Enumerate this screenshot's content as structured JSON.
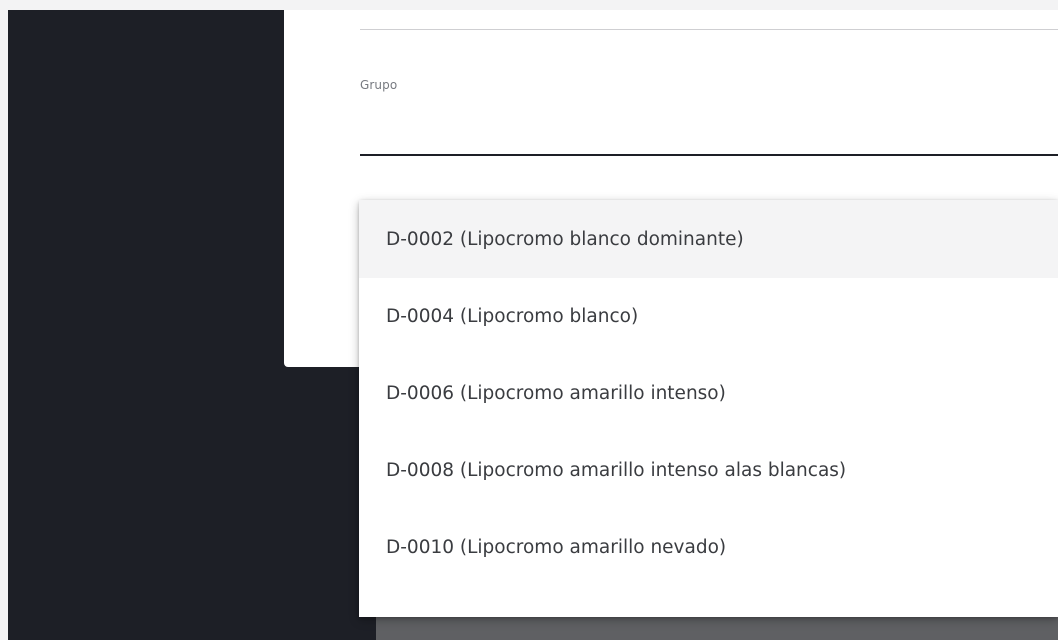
{
  "form": {
    "group_label": "Grupo",
    "group_value": ""
  },
  "dropdown": {
    "highlighted_index": 0,
    "options": [
      "D-0002 (Lipocromo blanco dominante)",
      "D-0004 (Lipocromo blanco)",
      "D-0006 (Lipocromo amarillo intenso)",
      "D-0008 (Lipocromo amarillo intenso alas blancas)",
      "D-0010 (Lipocromo amarillo nevado)"
    ]
  },
  "colors": {
    "backdrop": "#1d1f26",
    "card": "#ffffff",
    "highlight": "#f4f4f5",
    "text": "#3a3c40",
    "label": "#777a80"
  }
}
